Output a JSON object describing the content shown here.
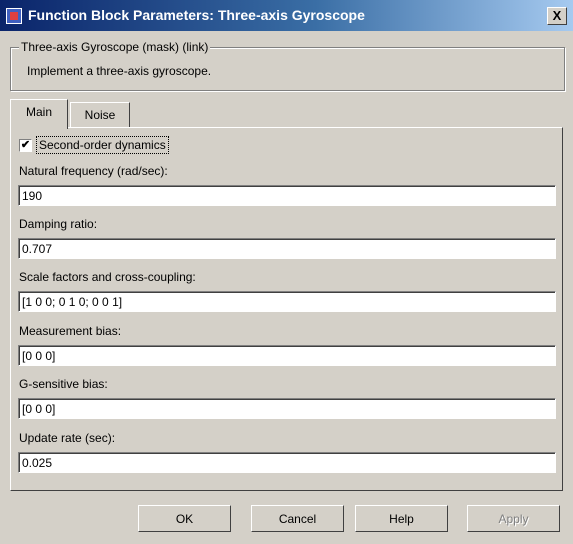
{
  "window": {
    "title": "Function Block Parameters: Three-axis Gyroscope",
    "close_label": "X"
  },
  "mask": {
    "legend": "Three-axis Gyroscope (mask) (link)",
    "description": "Implement a three-axis gyroscope."
  },
  "tabs": [
    {
      "label": "Main"
    },
    {
      "label": "Noise"
    }
  ],
  "main": {
    "second_order": {
      "label": "Second-order dynamics",
      "checked": true,
      "mark": "✔"
    },
    "fields": [
      {
        "label": "Natural frequency (rad/sec):",
        "value": "190"
      },
      {
        "label": "Damping ratio:",
        "value": "0.707"
      },
      {
        "label": "Scale factors and cross-coupling:",
        "value": "[1 0 0; 0 1 0; 0 0 1]"
      },
      {
        "label": "Measurement bias:",
        "value": "[0 0 0]"
      },
      {
        "label": "G-sensitive bias:",
        "value": "[0 0 0]"
      },
      {
        "label": "Update rate (sec):",
        "value": "0.025"
      }
    ]
  },
  "buttons": {
    "ok": "OK",
    "cancel": "Cancel",
    "help": "Help",
    "apply": "Apply"
  }
}
